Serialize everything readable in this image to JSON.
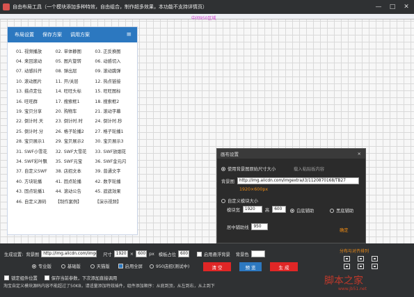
{
  "window": {
    "title": "自由布局工具（一个模块添加多种特效，自由组合，制作超多效果，本功能不支持详情页）",
    "minimize": "—",
    "maximize": "□",
    "close": "✕"
  },
  "canvas": {
    "top_label": "中间950区域"
  },
  "panel": {
    "tabs": [
      "布局设置",
      "保存方案",
      "调用方案"
    ],
    "menu_icon": "≡",
    "rows": [
      [
        "01. 视频播放",
        "02. 单体静图",
        "03. 正反换图"
      ],
      [
        "04. 来回滚动",
        "05. 图片旋转",
        "06. 动感切入"
      ],
      [
        "07. 动感抖开",
        "08. 弹出层",
        "09. 滚动跳弹"
      ],
      [
        "10. 滚动图片",
        "11. 开/关层",
        "12. 热点链接"
      ],
      [
        "13. 描点定位",
        "14. 旺旺头标",
        "15. 旺旺图标"
      ],
      [
        "16. 旺旺群",
        "17. 搜索框1",
        "18. 搜索框2"
      ],
      [
        "19. 宝贝分享",
        "20. 购物车",
        "21. 滚动字幕"
      ],
      [
        "22. 倒计时.天",
        "23. 倒计时.时",
        "24. 倒计时.秒"
      ],
      [
        "25. 倒计时.分",
        "26. 格子轮播2",
        "27. 格子轮播1"
      ],
      [
        "28. 宝贝展示1",
        "29. 宝贝展示2",
        "30. 宝贝展示3"
      ],
      [
        "31. SWF小雪花",
        "32. SWF大雪花",
        "33. SWF放烟花"
      ],
      [
        "34. SWF彩叶飘",
        "35. SWF元宝",
        "36. SWF金元闪"
      ],
      [
        "37. 自定义SWF",
        "38. 店招文本",
        "39. 普通文字"
      ],
      [
        "40. 方块轮播",
        "41. 固点轮播",
        "42. 数字轮播"
      ],
      [
        "43. 固点轮播1",
        "44. 滚动公告",
        "45. 遮遮效果"
      ],
      [
        "46. 自定义源码",
        "【制作案例】",
        "【演示视频】"
      ]
    ]
  },
  "dialog": {
    "title": "画布设置",
    "close": "×",
    "opt_bg_size": "使用背景图原始尺寸大小",
    "paste_hint": "载入粘贴板内容",
    "bg_label": "背景图",
    "bg_url": "http://img.alicdn.com/imgextra/i3/1120870168/TB27",
    "bg_size_text": "1920×600px",
    "opt_custom": "自定义模块大小",
    "module_w_label": "模块宽",
    "module_w": "1920",
    "module_h_label": "高",
    "module_h": "600",
    "white_aux": "白底辅助",
    "black_aux": "黑底辅助",
    "center_aux_label": "居中辅助线",
    "center_aux": "950",
    "confirm": "确定"
  },
  "bottom": {
    "gen_label": "生成设置:",
    "bg_label": "背景图",
    "bg_url": "http://img.alicdn.com/imgext",
    "size_label": "尺寸",
    "size_w": "1920",
    "size_sep": "×",
    "size_h": "600",
    "px": "px",
    "canvas_pos_label": "模板占位",
    "canvas_pos": "600",
    "float_bg": "启用悬浮背景",
    "bg_color_label": "背景色",
    "opt_pro": "专业版",
    "opt_basic": "基础版",
    "opt_tmall": "天猫版",
    "fullscreen": "启用全屏",
    "opt_950": "950店招(测试中)",
    "btn_clear": "清 空",
    "btn_preview": "预 览",
    "btn_generate": "生 成",
    "lock_pos": "锁定组件位置",
    "save_params": "保存当前参数，下次添加直接调用",
    "spacing_title": "分布与对齐排列",
    "note": "淘宝自定义模块源码内容不能超过了50KB，请适量添加特效插件，组件添加顺序：从底到顶，从左到右，从上到下"
  },
  "watermark": {
    "text": "脚本之家",
    "url": "www.jb51.net"
  },
  "colors": {
    "panel_header": "#2c78c0",
    "dark_bg": "#2f3133",
    "accent_orange": "#f08c14",
    "btn_red": "#e02626",
    "btn_blue": "#2c78c0"
  }
}
